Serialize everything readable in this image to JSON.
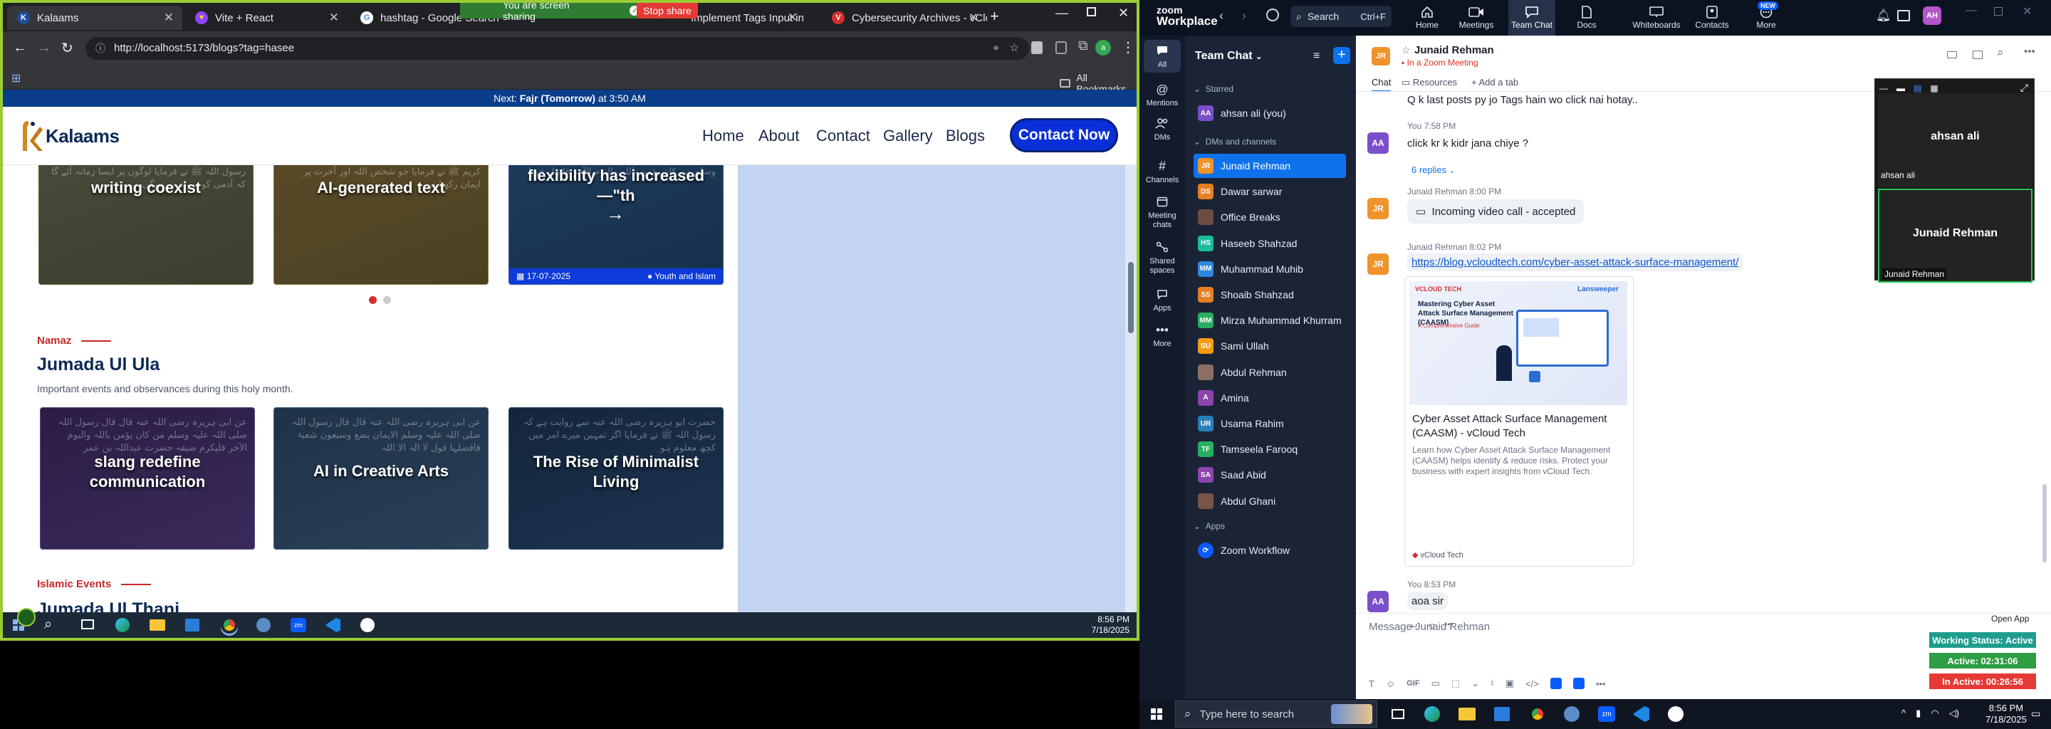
{
  "browser": {
    "tabs": [
      {
        "label": "Kalaams",
        "fav_color": "#1f4b99"
      },
      {
        "label": "Vite + React",
        "fav_color": "#8e44ff"
      },
      {
        "label": "hashtag - Google Search",
        "fav_color": "#ffffff"
      },
      {
        "label": "Implement Tags Input in Blo",
        "fav_color": "#10a37f"
      },
      {
        "label": "Cybersecurity Archives - vClo",
        "fav_color": "#d32f2f"
      }
    ],
    "share_text": "You are screen sharing",
    "stop_share": "Stop share",
    "url": "http://localhost:5173/blogs?tag=hasee",
    "bookmarks_label": "All Bookmarks"
  },
  "site": {
    "prayer_prefix": "Next: ",
    "prayer_name": "Fajr (Tomorrow)",
    "prayer_time": " at 3:50 AM",
    "logo": "Kalaams",
    "nav": [
      "Home",
      "About",
      "Contact",
      "Gallery",
      "Blogs"
    ],
    "contact_btn": "Contact Now",
    "top_cards": [
      {
        "title": "writing coexist"
      },
      {
        "title": "AI-generated text"
      },
      {
        "title": "flexibility has increased —\"th",
        "date": "17-07-2025",
        "category": "Youth and Islam"
      }
    ],
    "section1": {
      "kicker": "Namaz",
      "title": "Jumada Ul Ula",
      "desc": "Important events and observances during this holy month.",
      "cards": [
        {
          "title": "slang redefine communication"
        },
        {
          "title": "AI in Creative Arts"
        },
        {
          "title": "The Rise of Minimalist Living"
        }
      ]
    },
    "section2": {
      "kicker": "Islamic Events",
      "title": "Jumada Ul Thani"
    }
  },
  "left_taskbar": {
    "time": "8:56 PM",
    "date": "7/18/2025"
  },
  "zoom": {
    "brand_top": "zoom",
    "brand_bottom": "Workplace",
    "search": "Search",
    "search_shortcut": "Ctrl+F",
    "top_nav": [
      {
        "label": "Home",
        "icon": "home-icon"
      },
      {
        "label": "Meetings",
        "icon": "video-icon"
      },
      {
        "label": "Team Chat",
        "icon": "chat-icon"
      },
      {
        "label": "Docs",
        "icon": "doc-icon"
      },
      {
        "label": "Whiteboards",
        "icon": "whiteboard-icon"
      },
      {
        "label": "Contacts",
        "icon": "contacts-icon"
      },
      {
        "label": "More",
        "icon": "more-icon"
      }
    ],
    "new_badge": "NEW",
    "user_initials": "AH",
    "rail": [
      {
        "label": "All"
      },
      {
        "label": "Mentions"
      },
      {
        "label": "DMs"
      },
      {
        "label": "Channels"
      },
      {
        "label": "Meeting chats"
      },
      {
        "label": "Shared spaces"
      },
      {
        "label": "Apps"
      },
      {
        "label": "More"
      }
    ],
    "list_title": "Team Chat",
    "starred_label": "Starred",
    "starred_item": {
      "name": "ahsan ali (you)",
      "initials": "AA",
      "color": "#7b4fc9"
    },
    "dms_label": "DMs and channels",
    "contacts": [
      {
        "name": "Junaid Rehman",
        "initials": "JR",
        "color": "#f0932b"
      },
      {
        "name": "Dawar sarwar",
        "initials": "DS",
        "color": "#e67e22"
      },
      {
        "name": "Office Breaks",
        "initials": "",
        "color": "#6d4c41"
      },
      {
        "name": "Haseeb Shahzad",
        "initials": "HS",
        "color": "#1abc9c"
      },
      {
        "name": "Muhammad Muhib",
        "initials": "MM",
        "color": "#2e86de"
      },
      {
        "name": "Shoaib Shahzad",
        "initials": "SS",
        "color": "#e67e22"
      },
      {
        "name": "Mirza Muhammad Khurram",
        "initials": "MM",
        "color": "#27ae60"
      },
      {
        "name": "Sami Ullah",
        "initials": "SU",
        "color": "#f39c12"
      },
      {
        "name": "Abdul Rehman",
        "initials": "",
        "color": "#8d6e63"
      },
      {
        "name": "Amina",
        "initials": "A",
        "color": "#8e44ad"
      },
      {
        "name": "Usama Rahim",
        "initials": "UR",
        "color": "#2980b9"
      },
      {
        "name": "Tamseela Farooq",
        "initials": "TF",
        "color": "#27ae60"
      },
      {
        "name": "Saad Abid",
        "initials": "SA",
        "color": "#8e44ad"
      },
      {
        "name": "Abdul Ghani",
        "initials": "",
        "color": "#795548"
      }
    ],
    "apps_label": "Apps",
    "app_item": "Zoom Workflow",
    "chat": {
      "name": "Junaid Rehman",
      "status": "In a Zoom Meeting",
      "tabs": [
        "Chat",
        "Resources",
        "Add a tab"
      ],
      "partial_msg": "Q k last posts py jo Tags hain wo click nai hotay..",
      "msg1_meta": "You 7:58 PM",
      "msg1": "click kr k kidr jana chiye ?",
      "replies": "6 replies",
      "msg2_meta": "Junaid Rehman 8:00 PM",
      "msg2": "Incoming video call - accepted",
      "msg3_meta": "Junaid Rehman 8:02 PM",
      "msg3_link": "https://blog.vcloudtech.com/cyber-asset-attack-surface-management/",
      "preview_brand1": "VCLOUD TECH",
      "preview_brand2": "Lansweeper",
      "preview_img_title": "Mastering Cyber Asset Attack Surface Management (CAASM)",
      "preview_img_sub": "A Comprehensive Guide",
      "preview_title": "Cyber Asset Attack Surface Management (CAASM) - vCloud Tech",
      "preview_desc": "Learn how Cyber Asset Attack Surface Management (CAASM) helps identify & reduce risks. Protect your business with expert insights from vCloud Tech.",
      "preview_source": "vCloud Tech",
      "msg4_meta": "You 8:53 PM",
      "msg4": "aoa sir",
      "input_placeholder": "Message Junaid Rehman",
      "gif_label": "GIF",
      "open_app": "Open App"
    },
    "video": {
      "tile1_name": "ahsan ali",
      "tile1_label": "ahsan ali",
      "tile2_name": "Junaid Rehman",
      "tile2_label": "Junaid Rehman"
    },
    "status": {
      "working": "Working Status: Active",
      "active": "Active: 02:31:06",
      "inactive": "In Active: 00:26:56"
    }
  },
  "right_taskbar": {
    "search_placeholder": "Type here to search",
    "time": "8:56 PM",
    "date": "7/18/2025"
  },
  "colors": {
    "share_green": "#2e7d32",
    "stop_red": "#e53935",
    "zoom_blue": "#0b5cff",
    "selected_contact": "#0e72ed"
  }
}
